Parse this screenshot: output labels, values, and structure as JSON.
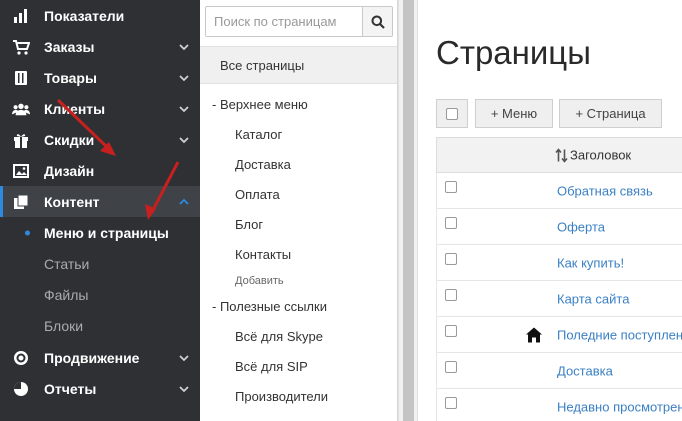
{
  "sidebar": {
    "items": [
      {
        "label": "Показатели",
        "icon": "bar-chart-icon",
        "chevron": false
      },
      {
        "label": "Заказы",
        "icon": "cart-icon",
        "chevron": true
      },
      {
        "label": "Товары",
        "icon": "book-icon",
        "chevron": true
      },
      {
        "label": "Клиенты",
        "icon": "users-icon",
        "chevron": true
      },
      {
        "label": "Скидки",
        "icon": "gift-icon",
        "chevron": true
      },
      {
        "label": "Дизайн",
        "icon": "image-icon",
        "chevron": false
      },
      {
        "label": "Контент",
        "icon": "copy-icon",
        "chevron": true,
        "expanded": true
      },
      {
        "label": "Продвижение",
        "icon": "target-icon",
        "chevron": true
      },
      {
        "label": "Отчеты",
        "icon": "pie-icon",
        "chevron": true
      }
    ],
    "sub_items": [
      {
        "label": "Меню и страницы",
        "active": true
      },
      {
        "label": "Статьи"
      },
      {
        "label": "Файлы"
      },
      {
        "label": "Блоки"
      }
    ],
    "accent_color": "#2e8ade"
  },
  "tree": {
    "search_placeholder": "Поиск по страницам",
    "all_pages": "Все страницы",
    "menus": [
      {
        "label": "-  Верхнее меню",
        "children": [
          "Каталог",
          "Доставка",
          "Оплата",
          "Блог",
          "Контакты"
        ],
        "add_label": "Добавить"
      },
      {
        "label": "-  Полезные ссылки",
        "children": [
          "Всё для Skype",
          "Всё для SIP",
          "Производители"
        ]
      }
    ]
  },
  "main": {
    "title": "Страницы",
    "toolbar": {
      "menu_button": "+ Меню",
      "page_button": "+ Страница"
    },
    "table": {
      "header": "Заголовок",
      "rows": [
        {
          "title": "Обратная связь",
          "home": false
        },
        {
          "title": "Оферта",
          "home": false
        },
        {
          "title": "Как купить!",
          "home": false
        },
        {
          "title": "Карта сайта",
          "home": false
        },
        {
          "title": "Поледние поступления",
          "home": true
        },
        {
          "title": "Доставка",
          "home": false
        },
        {
          "title": "Недавно просмотренные",
          "home": false
        }
      ]
    },
    "link_color": "#3b80c4"
  },
  "annotations": {
    "arrow_color": "#c8201e"
  }
}
